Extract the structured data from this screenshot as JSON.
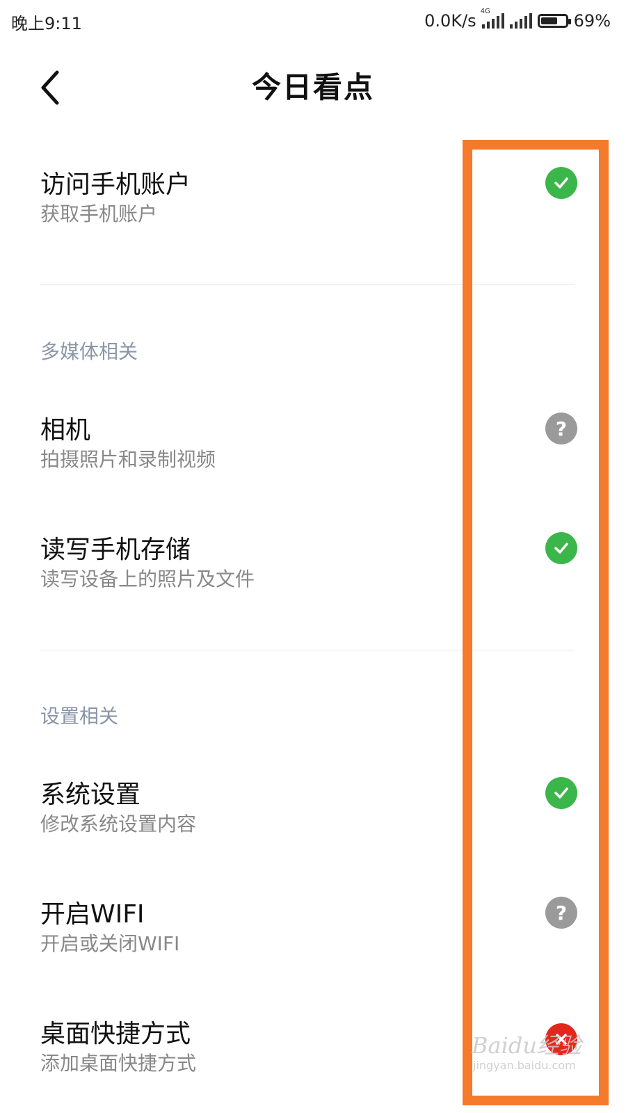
{
  "status_bar": {
    "time": "晚上9:11",
    "speed": "0.0K/s",
    "net_type": "4G",
    "battery_pct": "69%",
    "battery_level": 0.69
  },
  "nav": {
    "title": "今日看点",
    "back_icon": "chevron-left-icon"
  },
  "items": [
    {
      "title": "访问手机账户",
      "desc": "获取手机账户",
      "status": "allowed",
      "icon": "check-circle-icon"
    },
    {
      "title": "相机",
      "desc": "拍摄照片和录制视频",
      "status": "ask",
      "icon": "question-circle-icon"
    },
    {
      "title": "读写手机存储",
      "desc": "读写设备上的照片及文件",
      "status": "allowed",
      "icon": "check-circle-icon"
    },
    {
      "title": "系统设置",
      "desc": "修改系统设置内容",
      "status": "allowed",
      "icon": "check-circle-icon"
    },
    {
      "title": "开启WIFI",
      "desc": "开启或关闭WIFI",
      "status": "ask",
      "icon": "question-circle-icon"
    },
    {
      "title": "桌面快捷方式",
      "desc": "添加桌面快捷方式",
      "status": "denied",
      "icon": "x-circle-icon"
    }
  ],
  "sections": [
    {
      "label": "多媒体相关"
    },
    {
      "label": "设置相关"
    }
  ],
  "highlight_color": "#f57a2c",
  "watermark": {
    "text": "Baidu经验",
    "url": "jingyan.baidu.com"
  }
}
